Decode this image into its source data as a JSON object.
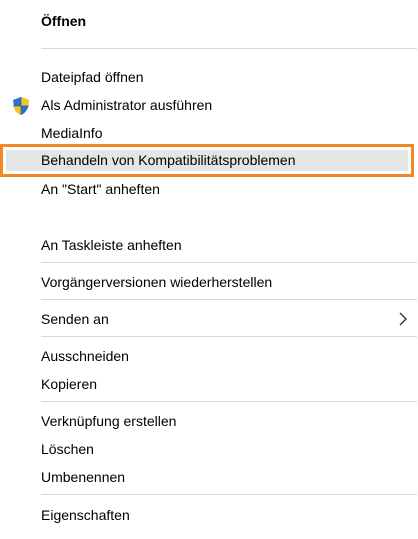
{
  "menu": {
    "items": [
      {
        "label": "Öffnen"
      },
      {
        "label": "Dateipfad öffnen"
      },
      {
        "label": "Als Administrator ausführen",
        "icon": "uac-shield-icon"
      },
      {
        "label": "MediaInfo"
      },
      {
        "label": "Behandeln von Kompatibilitätsproblemen",
        "highlighted": true
      },
      {
        "label": "An \"Start\" anheften"
      },
      {
        "label": "An Taskleiste anheften"
      },
      {
        "label": "Vorgängerversionen wiederherstellen"
      },
      {
        "label": "Senden an",
        "submenu_icon": "chevron-right-icon"
      },
      {
        "label": "Ausschneiden"
      },
      {
        "label": "Kopieren"
      },
      {
        "label": "Verknüpfung erstellen"
      },
      {
        "label": "Löschen"
      },
      {
        "label": "Umbenennen"
      },
      {
        "label": "Eigenschaften"
      }
    ]
  },
  "colors": {
    "highlight_border": "#f08a24",
    "hover_background": "#e5e5e5",
    "separator": "#d9d9d9",
    "shield_blue": "#2f6fcf",
    "shield_yellow": "#f3c623"
  }
}
